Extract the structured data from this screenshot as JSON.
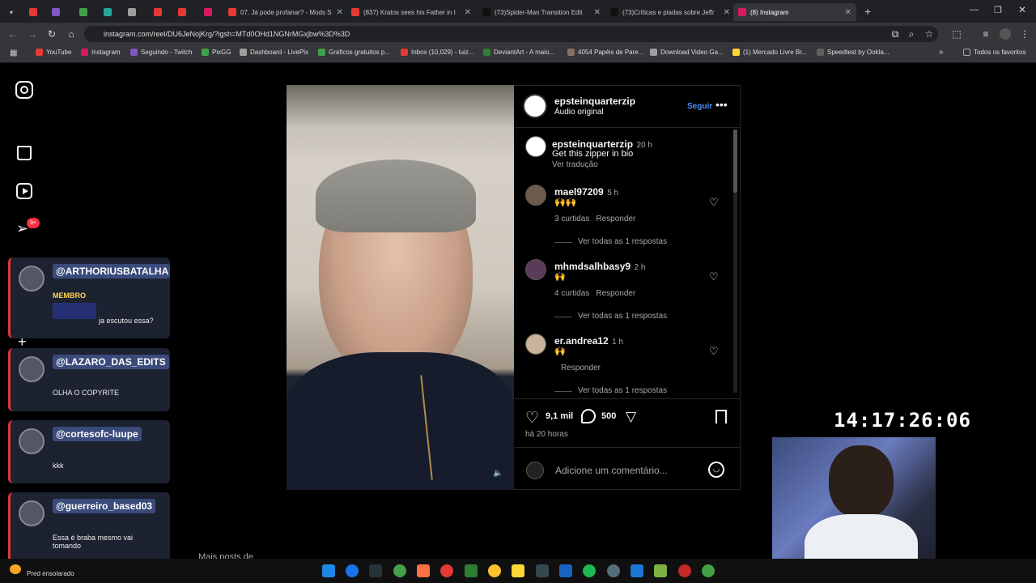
{
  "browser": {
    "tabs": [
      {
        "label": "",
        "color": "#e53935"
      },
      {
        "label": "",
        "color": "#7e57c2"
      },
      {
        "label": "",
        "color": "#43a047"
      },
      {
        "label": "",
        "color": "#26a69a"
      },
      {
        "label": "",
        "color": "#9e9e9e"
      },
      {
        "label": "",
        "color": "#e53935"
      },
      {
        "label": "",
        "color": "#e53935"
      },
      {
        "label": "",
        "color": "#d81b60"
      },
      {
        "label": "07. Já pode profanar? - Mods S",
        "color": "#e53935"
      },
      {
        "label": "(837) Kratos sees his Father in I",
        "color": "#e53935"
      },
      {
        "label": "(73)Spider-Man Transition Edit",
        "color": "#111111"
      },
      {
        "label": "(73)Críticas e piadas sobre Jeffr",
        "color": "#111111"
      },
      {
        "label": "(8) Instagram",
        "color": "#d81b60"
      }
    ],
    "url": "instagram.com/reel/DU6JeNojKrg/?igsh=MTd0OHd1NGNrMGxjbw%3D%3D",
    "bookmarks": [
      {
        "label": "YouTube",
        "color": "#e53935"
      },
      {
        "label": "Instagram",
        "color": "#d81b60"
      },
      {
        "label": "Seguindo - Twitch",
        "color": "#7e57c2"
      },
      {
        "label": "PixGG",
        "color": "#43a047"
      },
      {
        "label": "Dashboard - LivePix",
        "color": "#9e9e9e"
      },
      {
        "label": "Gráficos gratuitos p...",
        "color": "#43a047"
      },
      {
        "label": "Inbox (10,029) - luiz...",
        "color": "#e53935"
      },
      {
        "label": "DeviantArt - A maio...",
        "color": "#2e7d32"
      },
      {
        "label": "4054 Papéis de Pare...",
        "color": "#8d6e63"
      },
      {
        "label": "Download Video Ga...",
        "color": "#9e9e9e"
      },
      {
        "label": "(1) Mercado Livre Br...",
        "color": "#fdd835"
      },
      {
        "label": "Speedtest by Ookla...",
        "color": "#616161"
      }
    ],
    "all_bookmarks": "Todos os favoritos"
  },
  "reel": {
    "author": "epsteinquarterzip",
    "audio": "Áudio original",
    "follow": "Seguir",
    "caption_user": "epsteinquarterzip",
    "caption_time": "20 h",
    "caption": "Get this zipper in bio",
    "translate": "Ver tradução",
    "comments": [
      {
        "user": "mael97209",
        "time": "5 h",
        "text": "🙌🙌",
        "likes": "3 curtidas",
        "reply": "Responder",
        "replies": "Ver todas as 1 respostas"
      },
      {
        "user": "mhmdsalhbasy9",
        "time": "2 h",
        "text": "🙌",
        "likes": "4 curtidas",
        "reply": "Responder",
        "replies": "Ver todas as 1 respostas"
      },
      {
        "user": "er.andrea12",
        "time": "1 h",
        "text": "🙌",
        "likes": "",
        "reply": "Responder",
        "replies": "Ver todas as 1 respostas"
      }
    ],
    "like_count": "9,1 mil",
    "comment_count": "500",
    "posted": "há 20 horas",
    "add_comment": "Adicione um comentário..."
  },
  "more_posts": "Mais posts de",
  "chat": [
    {
      "name": "@ARTHORIUSBATALHA",
      "badge": "MEMBRO",
      "msg": "ja escutou essa?"
    },
    {
      "name": "@LAZARO_DAS_EDITS",
      "badge": "",
      "msg": "OLHA O COPYRITE"
    },
    {
      "name": "@cortesofc-luupe",
      "badge": "",
      "msg": "kkk"
    },
    {
      "name": "@guerreiro_based03",
      "badge": "",
      "msg": "Essa é braba mesmo vai tomando"
    }
  ],
  "overlay": {
    "clock": "14:17:26:06",
    "weather": "Pred ensolarado",
    "notif_badge": "9+"
  }
}
